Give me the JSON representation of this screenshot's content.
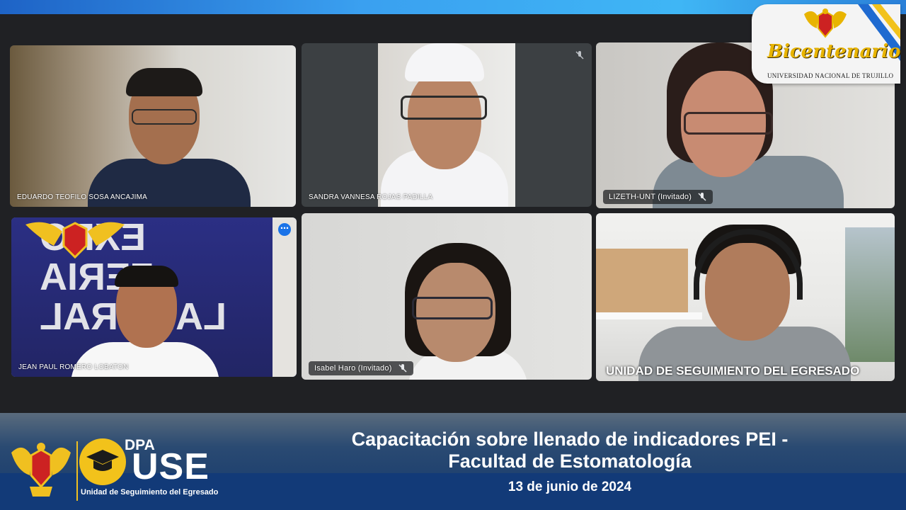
{
  "meeting": {
    "participants": [
      {
        "name": "EDUARDO TEOFILO SOSA ANCAJIMA"
      },
      {
        "name": "SANDRA VANNESA ROJAS PADILLA"
      },
      {
        "name": "LIZETH-UNT (Invitado)"
      },
      {
        "name": "JEAN PAUL ROMERO LOBATON"
      },
      {
        "name": "Isabel Haro (Invitado)"
      },
      {
        "name": "UNIDAD DE SEGUIMIENTO DEL EGRESADO"
      }
    ],
    "banner_letters": [
      "EXPO",
      "FERIA",
      "LABORAL"
    ]
  },
  "branding": {
    "badge_title": "Bicentenario",
    "badge_subtitle": "UNIVERSIDAD NACIONAL DE TRUJILLO",
    "dpa": "DPA",
    "use": "USE",
    "use_subtitle": "Unidad de Seguimiento del Egresado"
  },
  "footer": {
    "title_line1": "Capacitación sobre llenado de indicadores PEI -",
    "title_line2": "Facultad de Estomatología",
    "date": "13 de junio de 2024"
  },
  "colors": {
    "accent_blue": "#1a73e8",
    "gold": "#f2c21b",
    "footer_navy": "#14386c"
  }
}
